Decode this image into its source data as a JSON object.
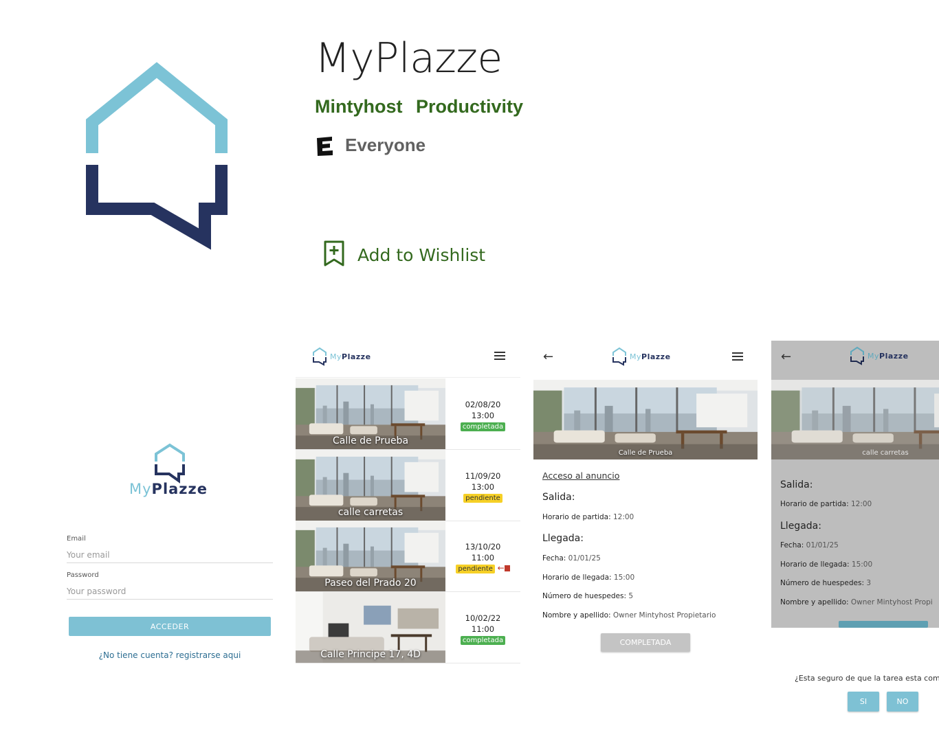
{
  "app": {
    "title": "MyPlazze",
    "developer": "Mintyhost",
    "category": "Productivity",
    "rating": "Everyone",
    "rating_icon": "esrb-everyone-icon",
    "wishlist_label": "Add to Wishlist",
    "accent_color": "#33691e"
  },
  "brand": {
    "my": "My",
    "plazze": "Plazze",
    "light_color": "#7cc3d6",
    "dark_color": "#26335f"
  },
  "login": {
    "email_label": "Email",
    "email_placeholder": "Your email",
    "password_label": "Password",
    "password_placeholder": "Your password",
    "submit_label": "ACCEDER",
    "register_link": "¿No tiene cuenta? registrarse aqui"
  },
  "tasks": [
    {
      "name": "Calle de Prueba",
      "date": "02/08/20",
      "time": "13:00",
      "status": "completada"
    },
    {
      "name": "calle carretas",
      "date": "11/09/20",
      "time": "13:00",
      "status": "pendiente"
    },
    {
      "name": "Paseo del Prado 20",
      "date": "13/10/20",
      "time": "11:00",
      "status": "pendiente"
    },
    {
      "name": "Calle Principe 17, 4D",
      "date": "10/02/22",
      "time": "11:00",
      "status": "completada"
    }
  ],
  "detail": {
    "caption": "Calle de Prueba",
    "listing_link": "Acceso al anuncio",
    "salida_heading": "Salida:",
    "departure_label": "Horario de partida:",
    "departure_value": "12:00",
    "llegada_heading": "Llegada:",
    "date_label": "Fecha:",
    "date_value": "01/01/25",
    "arrival_label": "Horario de llegada:",
    "arrival_value": "15:00",
    "guests_label": "Número de huespedes:",
    "guests_value": "5",
    "name_label": "Nombre y apellido:",
    "name_value": "Owner Mintyhost Propietario",
    "complete_label": "COMPLETADA"
  },
  "confirm": {
    "caption": "calle carretas",
    "salida_heading": "Salida:",
    "departure_label": "Horario de partida:",
    "departure_value": "12:00",
    "llegada_heading": "Llegada:",
    "date_label": "Fecha:",
    "date_value": "01/01/25",
    "arrival_label": "Horario de llegada:",
    "arrival_value": "15:00",
    "guests_label": "Número de huespedes:",
    "guests_value": "3",
    "name_label": "Nombre y apellido:",
    "name_value": "Owner Mintyhost Propi",
    "question": "¿Esta seguro de que la tarea esta com",
    "yes_label": "SI",
    "no_label": "NO"
  }
}
